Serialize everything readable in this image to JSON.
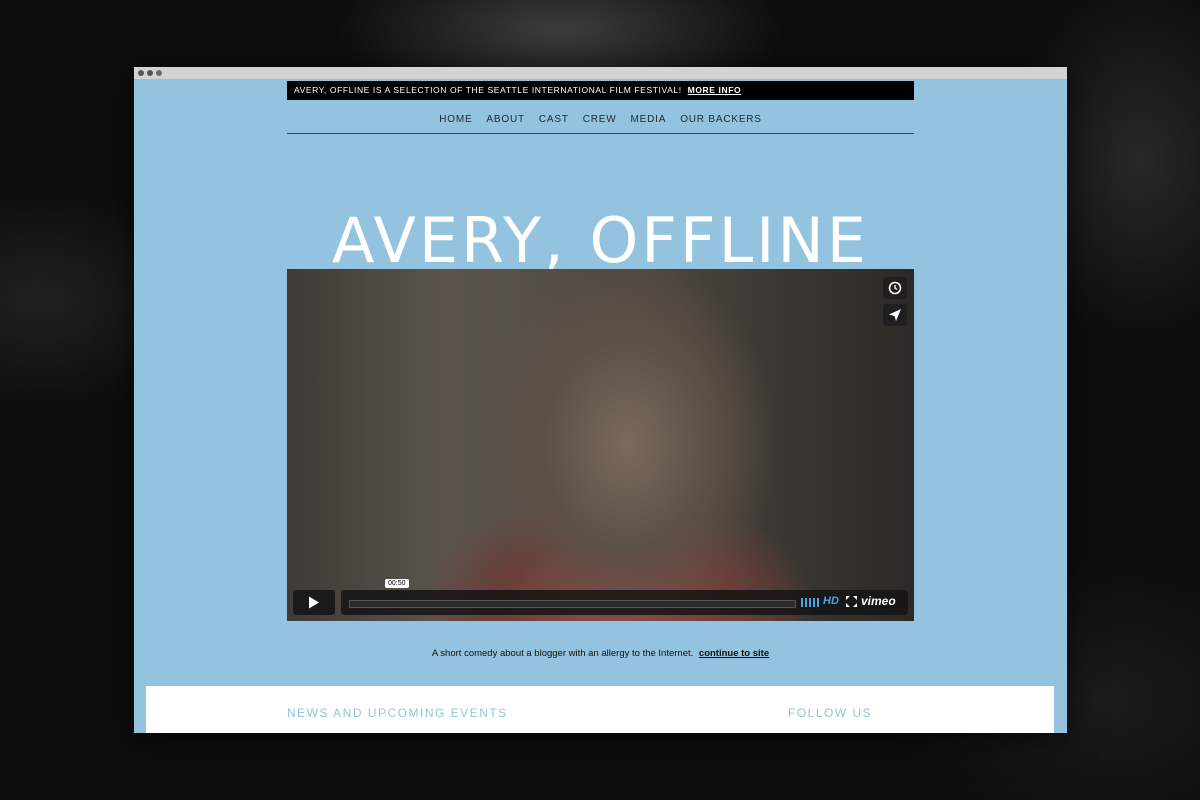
{
  "announcement": {
    "text": "AVERY, OFFLINE IS A SELECTION OF THE SEATTLE INTERNATIONAL FILM FESTIVAL!",
    "link": "MORE INFO"
  },
  "nav": {
    "items": [
      "HOME",
      "ABOUT",
      "CAST",
      "CREW",
      "MEDIA",
      "OUR BACKERS"
    ]
  },
  "hero": {
    "title": "AVERY, OFFLINE"
  },
  "video": {
    "time_tooltip": "00:50",
    "hd_label": "HD",
    "brand": "vimeo",
    "progress": 0.0,
    "icons": [
      "clock-icon",
      "paper-plane-icon",
      "play-icon",
      "volume-icon",
      "fullscreen-icon"
    ]
  },
  "tagline": {
    "text": "A short comedy about a blogger with an allergy to the Internet.",
    "link": "continue to site"
  },
  "panel": {
    "news_heading": "NEWS AND UPCOMING EVENTS",
    "follow_heading": "FOLLOW US"
  },
  "colors": {
    "page_background": "#93c3de",
    "announcement_bar": "#000000",
    "accent_blue": "#4aa3df"
  }
}
